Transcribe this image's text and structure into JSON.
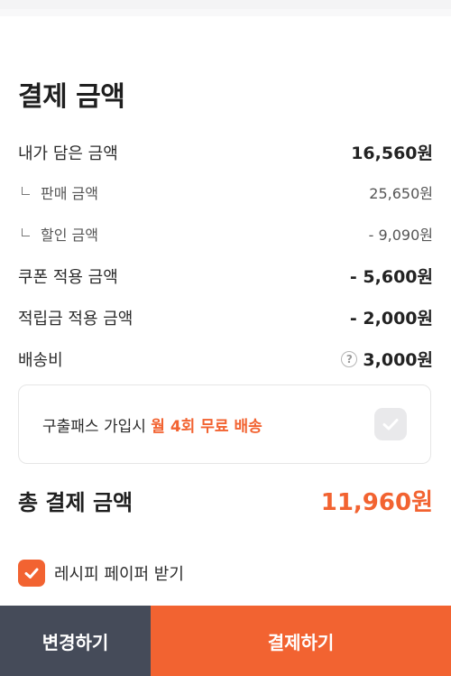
{
  "section_title": "결제 금액",
  "rows": {
    "cart": {
      "label": "내가 담은 금액",
      "value": "16,560원"
    },
    "sale_price": {
      "label": "판매 금액",
      "value": "25,650원"
    },
    "discount": {
      "label": "할인 금액",
      "value": "- 9,090원"
    },
    "coupon": {
      "label": "쿠폰 적용 금액",
      "value": "- 5,600원"
    },
    "points": {
      "label": "적립금 적용 금액",
      "value": "- 2,000원"
    },
    "shipping": {
      "label": "배송비",
      "info_icon": "?",
      "value": "3,000원"
    }
  },
  "pass_box": {
    "text_prefix": "구출패스 가입시 ",
    "text_highlight": "월 4회 무료 배송",
    "checked": false
  },
  "total": {
    "label": "총 결제 금액",
    "value": "11,960원"
  },
  "recipe": {
    "label": "레시피 페이퍼 받기",
    "checked": true
  },
  "buttons": {
    "change": "변경하기",
    "pay": "결제하기"
  },
  "colors": {
    "accent": "#f26331",
    "dark_button": "#454b59"
  }
}
